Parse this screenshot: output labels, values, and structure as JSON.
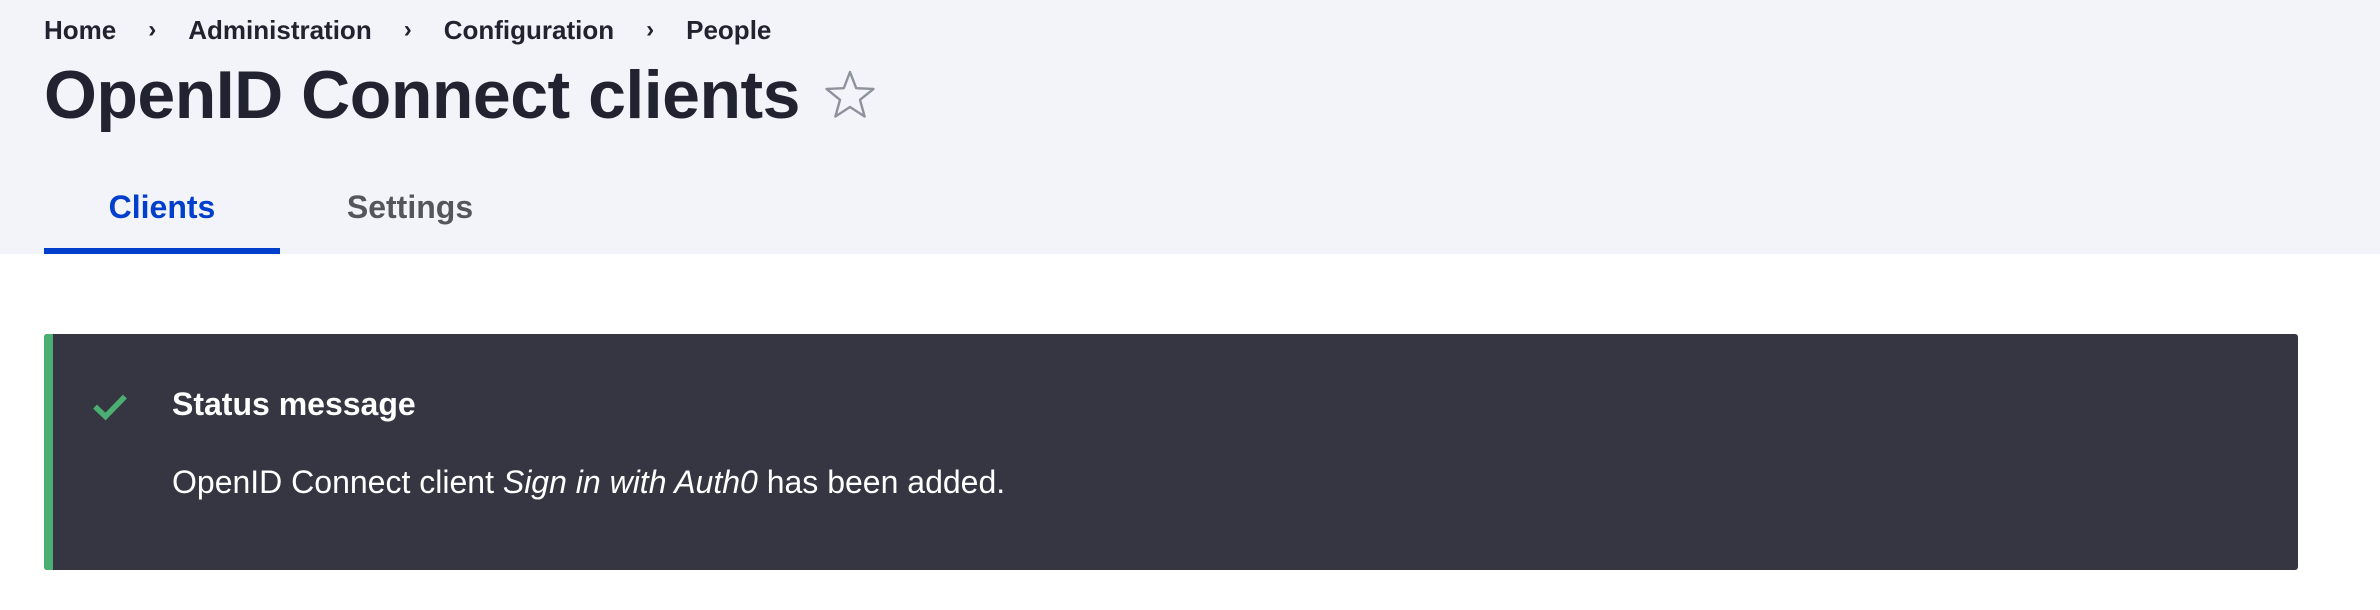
{
  "breadcrumb": {
    "items": [
      "Home",
      "Administration",
      "Configuration",
      "People"
    ],
    "separator": "›"
  },
  "page": {
    "title": "OpenID Connect clients",
    "shortcut_icon": "star-outline-icon"
  },
  "tabs": [
    {
      "label": "Clients",
      "active": true
    },
    {
      "label": "Settings",
      "active": false
    }
  ],
  "status": {
    "icon": "checkmark-icon",
    "title": "Status message",
    "message_prefix": "OpenID Connect client",
    "client_name": "Sign in with Auth0",
    "message_suffix": "has been added."
  },
  "colors": {
    "accent": "#003ecc",
    "header_background": "#f3f4f9",
    "status_background": "#353641",
    "status_success": "#4caf72"
  }
}
